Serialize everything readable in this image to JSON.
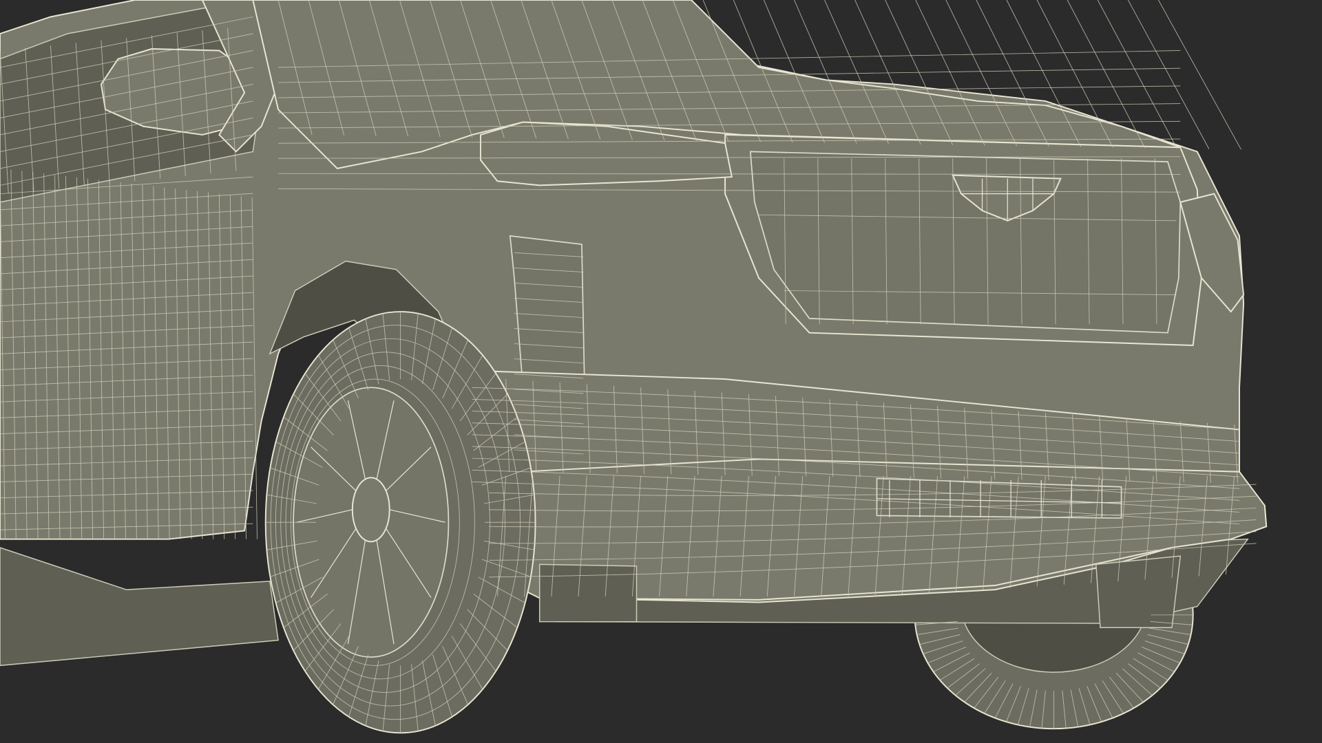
{
  "scene": {
    "subject": "wireframe-suv-front-quarter",
    "background_color": "#2b2b2b",
    "body_color": "#7a7a6c",
    "body_shadow_color": "#5f5f54",
    "wire_color": "#e8e6d2",
    "wire_faint_color": "#cfcdb8",
    "tire_color": "#6c6c60",
    "cavity_color": "#4e4e45",
    "emblem": "cadillac-crest"
  }
}
